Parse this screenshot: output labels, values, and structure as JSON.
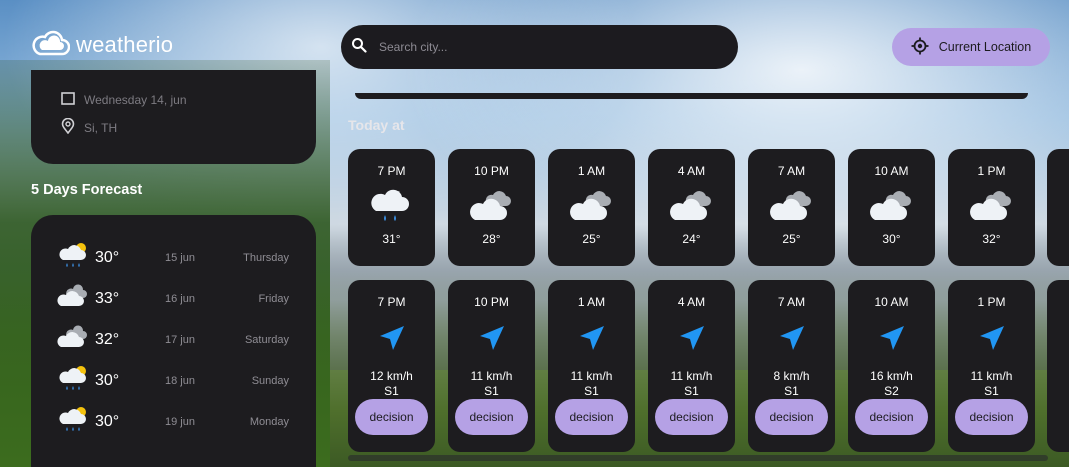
{
  "app": {
    "name": "weatherio"
  },
  "search": {
    "placeholder": "Search city..."
  },
  "location_button": {
    "label": "Current Location"
  },
  "current": {
    "date": "Wednesday 14, jun",
    "location": "Si, TH"
  },
  "forecast": {
    "title": "5 Days Forecast",
    "days": [
      {
        "temp": "30°",
        "date": "15 jun",
        "day": "Thursday",
        "icon": "rain-sun-icon"
      },
      {
        "temp": "33°",
        "date": "16 jun",
        "day": "Friday",
        "icon": "cloudy-icon"
      },
      {
        "temp": "32°",
        "date": "17 jun",
        "day": "Saturday",
        "icon": "cloudy-icon"
      },
      {
        "temp": "30°",
        "date": "18 jun",
        "day": "Sunday",
        "icon": "rain-sun-icon"
      },
      {
        "temp": "30°",
        "date": "19 jun",
        "day": "Monday",
        "icon": "rain-sun-icon"
      }
    ]
  },
  "today": {
    "title": "Today at",
    "hourly_temps": [
      {
        "time": "7 PM",
        "temp": "31°",
        "icon": "rain-night-icon"
      },
      {
        "time": "10 PM",
        "temp": "28°",
        "icon": "cloudy-icon"
      },
      {
        "time": "1 AM",
        "temp": "25°",
        "icon": "cloudy-icon"
      },
      {
        "time": "4 AM",
        "temp": "24°",
        "icon": "cloudy-icon"
      },
      {
        "time": "7 AM",
        "temp": "25°",
        "icon": "cloudy-icon"
      },
      {
        "time": "10 AM",
        "temp": "30°",
        "icon": "cloudy-icon"
      },
      {
        "time": "1 PM",
        "temp": "32°",
        "icon": "cloudy-icon"
      }
    ],
    "hourly_wind": [
      {
        "time": "7 PM",
        "speed": "12 km/h",
        "dir": "S1",
        "button": "decision"
      },
      {
        "time": "10 PM",
        "speed": "11 km/h",
        "dir": "S1",
        "button": "decision"
      },
      {
        "time": "1 AM",
        "speed": "11 km/h",
        "dir": "S1",
        "button": "decision"
      },
      {
        "time": "4 AM",
        "speed": "11 km/h",
        "dir": "S1",
        "button": "decision"
      },
      {
        "time": "7 AM",
        "speed": "8 km/h",
        "dir": "S1",
        "button": "decision"
      },
      {
        "time": "10 AM",
        "speed": "16 km/h",
        "dir": "S2",
        "button": "decision"
      },
      {
        "time": "1 PM",
        "speed": "11 km/h",
        "dir": "S1",
        "button": "decision"
      }
    ]
  },
  "colors": {
    "card": "#1d1c1f",
    "accent": "#b5a1e5",
    "wind_arrow": "#2196f3"
  }
}
